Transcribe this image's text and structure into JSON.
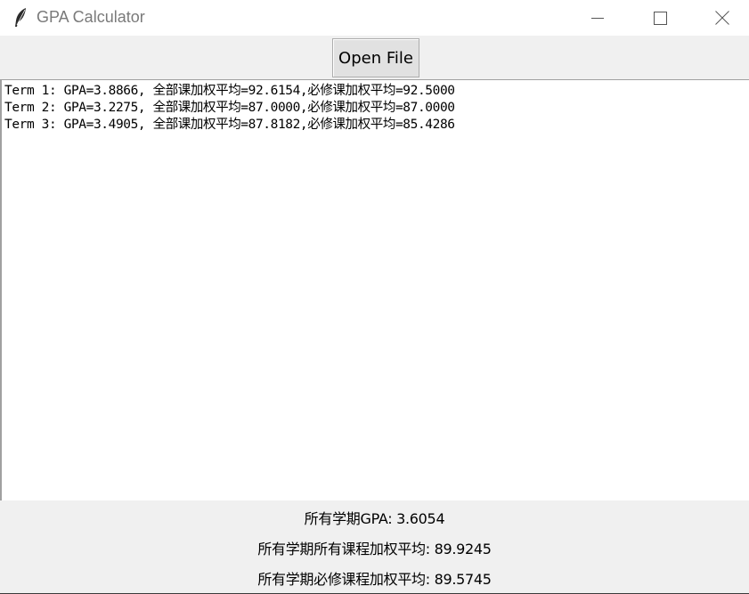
{
  "window": {
    "title": "GPA Calculator",
    "icon": "feather-icon",
    "controls": [
      "minimize-icon",
      "maximize-icon",
      "close-icon"
    ]
  },
  "toolbar": {
    "open_file_label": "Open File"
  },
  "output": {
    "lines": [
      "Term 1: GPA=3.8866, 全部课加权平均=92.6154,必修课加权平均=92.5000",
      "Term 2: GPA=3.2275, 全部课加权平均=87.0000,必修课加权平均=87.0000",
      "Term 3: GPA=3.4905, 全部课加权平均=87.8182,必修课加权平均=85.4286"
    ]
  },
  "summary": {
    "gpa_all": "所有学期GPA: 3.6054",
    "weighted_all": "所有学期所有课程加权平均: 89.9245",
    "weighted_required": "所有学期必修课程加权平均: 89.5745"
  }
}
